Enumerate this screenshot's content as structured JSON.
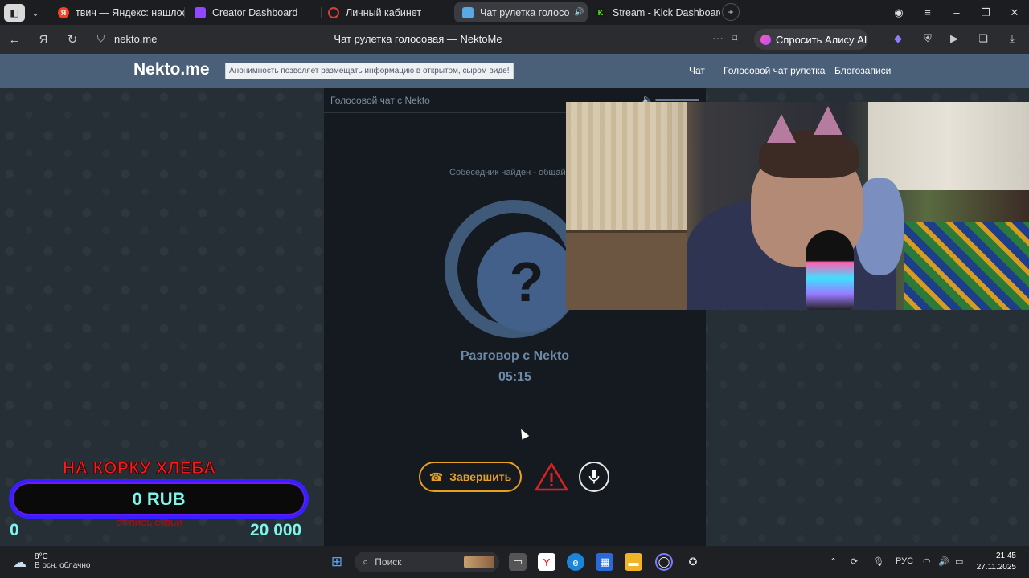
{
  "browser": {
    "tabs": [
      {
        "label": "твич — Яндекс: нашлось",
        "icon": "yandex-icon",
        "color": "#fc3f1d",
        "active": false
      },
      {
        "label": "Creator Dashboard",
        "icon": "twitch-icon",
        "color": "#9146ff",
        "active": false
      },
      {
        "label": "Личный кабинет",
        "icon": "circle-icon",
        "color": "#e53935",
        "active": false
      },
      {
        "label": "Чат рулетка голосо",
        "icon": "nekto-icon",
        "color": "#5aa9e6",
        "active": true
      },
      {
        "label": "Stream - Kick Dashboard",
        "icon": "kick-icon",
        "color": "#53fc18",
        "active": false
      }
    ],
    "url": "nekto.me",
    "page_title": "Чат рулетка голосовая — NektoMe",
    "alice_label": "Спросить Алису AI"
  },
  "site": {
    "logo": "Nekto.me",
    "tagline": "Анонимность позволяет размещать информацию в открытом, сыром виде!",
    "nav": [
      "Чат",
      "Голосовой чат рулетка",
      "Блогозаписи"
    ]
  },
  "chat": {
    "header": "Голосовой чат с Nekto",
    "found_text": "Собеседник найден - общай",
    "avatar_glyph": "?",
    "talk_title": "Разговор с Nekto",
    "talk_time": "05:15",
    "end_label": "Завершить"
  },
  "overlay": {
    "title": "НА КОРКУ ХЛЕБА",
    "amount": "0 RUB",
    "sub": "ОТ ПИСЬ СУДЬИ",
    "min": "0",
    "max": "20 000"
  },
  "taskbar": {
    "temp": "8°C",
    "weather_desc": "В осн. облачно",
    "search_placeholder": "Поиск",
    "lang": "РУС",
    "time": "21:45",
    "date": "27.11.2025"
  },
  "colors": {
    "accent": "#e8a020",
    "header_bg": "#4a6079",
    "warn": "#e02020"
  }
}
